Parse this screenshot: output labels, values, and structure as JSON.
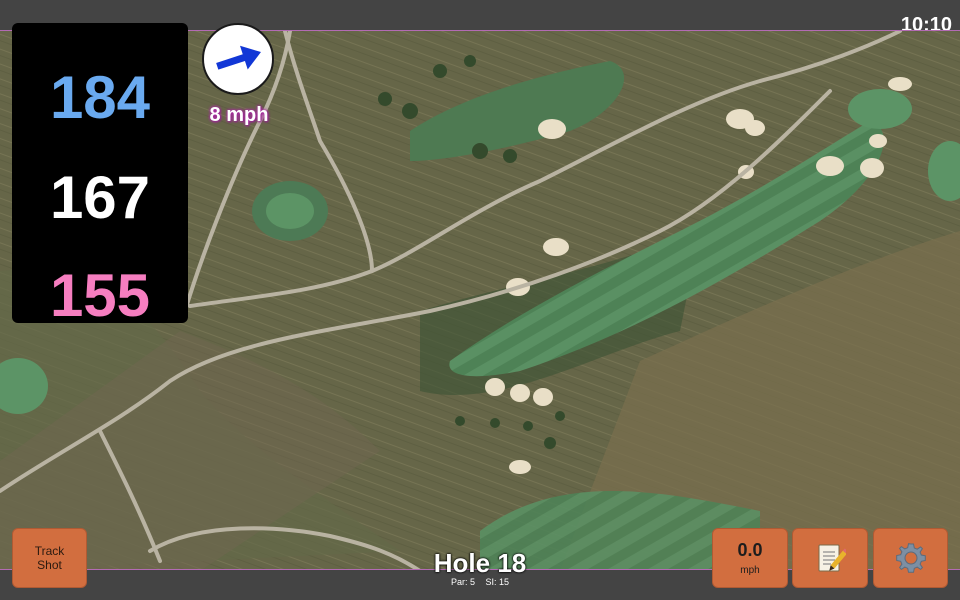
{
  "status_bar": {
    "time": "10:10"
  },
  "distances": {
    "back": "184",
    "middle": "167",
    "front": "155"
  },
  "wind": {
    "speed": "8 mph",
    "icon": "wind-arrow-icon"
  },
  "hole": {
    "title": "Hole 18",
    "par": "Par: 5",
    "stroke_index": "SI: 15"
  },
  "buttons": {
    "track_shot": {
      "line1": "Track",
      "line2": "Shot"
    },
    "speed": {
      "value": "0.0",
      "unit": "mph"
    },
    "notes": {
      "icon": "notepad-icon"
    },
    "settings": {
      "icon": "gear-icon"
    }
  },
  "colors": {
    "back_distance": "#6aaaf0",
    "middle_distance": "#ffffff",
    "front_distance": "#f67ec0",
    "button": "#d26e3f",
    "wind_arrow": "#1237d6"
  }
}
